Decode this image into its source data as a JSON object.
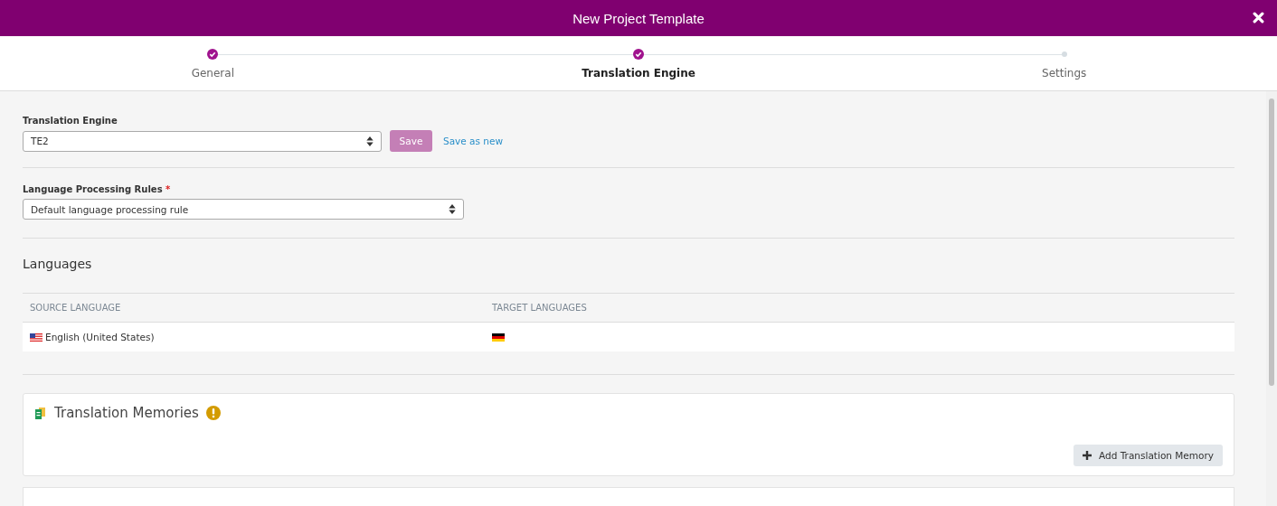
{
  "window": {
    "title": "New Project Template"
  },
  "steps": [
    {
      "label": "General",
      "completed": true,
      "selected": false
    },
    {
      "label": "Translation Engine",
      "completed": true,
      "selected": true
    },
    {
      "label": "Settings",
      "completed": false,
      "selected": false
    }
  ],
  "translation_engine": {
    "label": "Translation Engine",
    "value": "TE2",
    "save_button": {
      "label": "Save",
      "disabled": true
    },
    "save_as_new": "Save as new"
  },
  "language_processing_rules": {
    "label": "Language Processing Rules",
    "required": true,
    "required_mark": "*",
    "value": "Default language processing rule"
  },
  "languages": {
    "title": "Languages",
    "columns": [
      "SOURCE LANGUAGE",
      "TARGET LANGUAGES"
    ],
    "rows": [
      {
        "source": "English (United States)"
      }
    ]
  },
  "translation_memories": {
    "title": "Translation Memories",
    "warning": true,
    "add_button": "Add Translation Memory"
  }
}
